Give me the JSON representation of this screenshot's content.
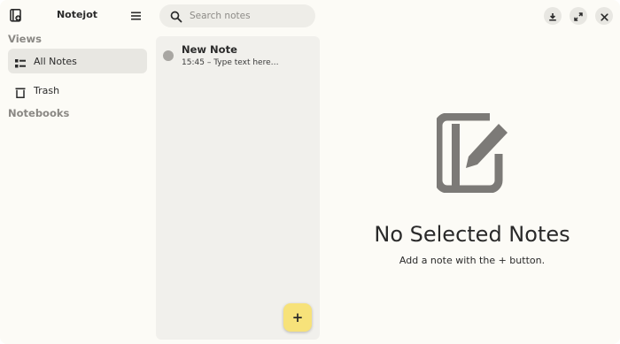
{
  "app": {
    "title": "Notejot"
  },
  "sidebar": {
    "views_label": "Views",
    "items": [
      {
        "label": "All Notes",
        "icon": "list-icon",
        "active": true
      },
      {
        "label": "Trash",
        "icon": "trash-icon",
        "active": false
      }
    ],
    "notebooks_label": "Notebooks"
  },
  "search": {
    "placeholder": "Search notes",
    "value": ""
  },
  "notes": [
    {
      "title": "New Note",
      "time": "15:45",
      "separator": "–",
      "preview": "Type text here…"
    }
  ],
  "fab": {
    "label": "+"
  },
  "empty_state": {
    "title": "No Selected Notes",
    "subtitle": "Add a note with the + button."
  },
  "colors": {
    "window_bg": "#fcfbf6",
    "panel_bg": "#f1f0ec",
    "active_item_bg": "#e8e7e2",
    "fab_bg": "#f7e27a",
    "note_dot": "#a8a6a2",
    "empty_icon": "#7c7a77"
  },
  "icons": {
    "app": "notebook-icon",
    "menu": "hamburger-menu-icon",
    "search": "search-icon",
    "export": "download-icon",
    "maximize": "maximize-icon",
    "close": "close-icon",
    "empty": "edit-note-icon"
  }
}
